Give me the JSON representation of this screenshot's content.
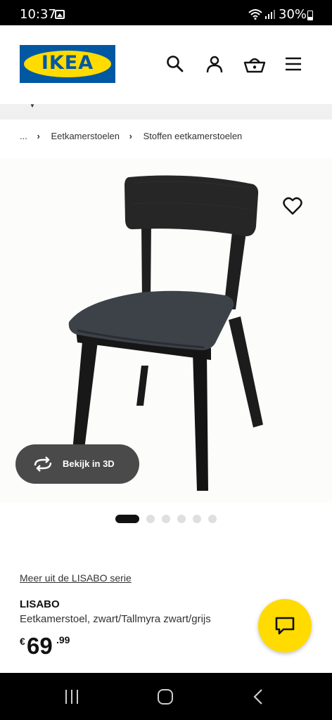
{
  "status_bar": {
    "time": "10:37",
    "battery": "30%"
  },
  "header": {
    "logo_text": "IKEA",
    "icons": [
      "search-icon",
      "user-icon",
      "basket-icon",
      "menu-icon"
    ]
  },
  "breadcrumb": {
    "items": [
      "...",
      "Eetkamerstoelen",
      "Stoffen eetkamerstoelen"
    ]
  },
  "gallery": {
    "view_3d_label": "Bekijk in 3D",
    "image_count": 6,
    "active_index": 0
  },
  "product": {
    "series_link": "Meer uit de LISABO serie",
    "name": "LISABO",
    "description": "Eetkamerstoel, zwart/Tallmyra zwart/grijs",
    "price_currency": "€",
    "price_integer": "69",
    "price_decimal": ".99"
  },
  "colors": {
    "ikea_blue": "#0058a3",
    "ikea_yellow": "#ffdb00",
    "pill_gray": "#4a4a4a"
  }
}
